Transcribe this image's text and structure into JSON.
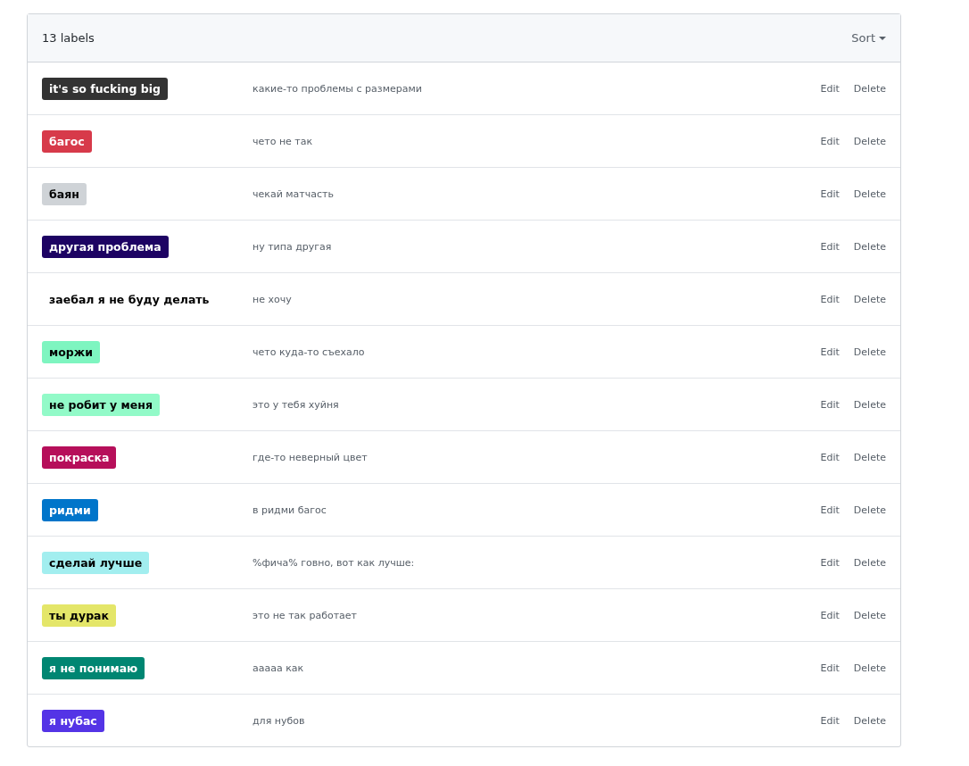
{
  "header": {
    "count": "13 labels",
    "sort": "Sort"
  },
  "labels": [
    {
      "name": "it's so fucking big",
      "color": "#333333",
      "description": "какие-то проблемы с размерами",
      "edit": "Edit",
      "delete": "Delete"
    },
    {
      "name": "багос",
      "color": "#d73a4a",
      "description": "чето не так",
      "edit": "Edit",
      "delete": "Delete"
    },
    {
      "name": "баян",
      "color": "#cfd3d7",
      "description": "чекай матчасть",
      "edit": "Edit",
      "delete": "Delete"
    },
    {
      "name": "другая проблема",
      "color": "#1d0363",
      "description": "ну типа другая",
      "edit": "Edit",
      "delete": "Delete"
    },
    {
      "name": "заебал я не буду делать",
      "color": "#ffffff",
      "description": "не хочу",
      "edit": "Edit",
      "delete": "Delete"
    },
    {
      "name": "моржи",
      "color": "#7ef5c0",
      "description": "чето куда-то съехало",
      "edit": "Edit",
      "delete": "Delete"
    },
    {
      "name": "не робит у меня",
      "color": "#92fac8",
      "description": "это у тебя хуйня",
      "edit": "Edit",
      "delete": "Delete"
    },
    {
      "name": "покраска",
      "color": "#b60f5a",
      "description": "где-то неверный цвет",
      "edit": "Edit",
      "delete": "Delete"
    },
    {
      "name": "ридми",
      "color": "#0075ca",
      "description": "в ридми багос",
      "edit": "Edit",
      "delete": "Delete"
    },
    {
      "name": "сделай лучше",
      "color": "#a2eeef",
      "description": "%фича% говно, вот как лучше:",
      "edit": "Edit",
      "delete": "Delete"
    },
    {
      "name": "ты дурак",
      "color": "#e4e669",
      "description": "это не так работает",
      "edit": "Edit",
      "delete": "Delete"
    },
    {
      "name": "я не понимаю",
      "color": "#008672",
      "description": "ааааа как",
      "edit": "Edit",
      "delete": "Delete"
    },
    {
      "name": "я нубас",
      "color": "#5434e6",
      "description": "для нубов",
      "edit": "Edit",
      "delete": "Delete"
    }
  ]
}
